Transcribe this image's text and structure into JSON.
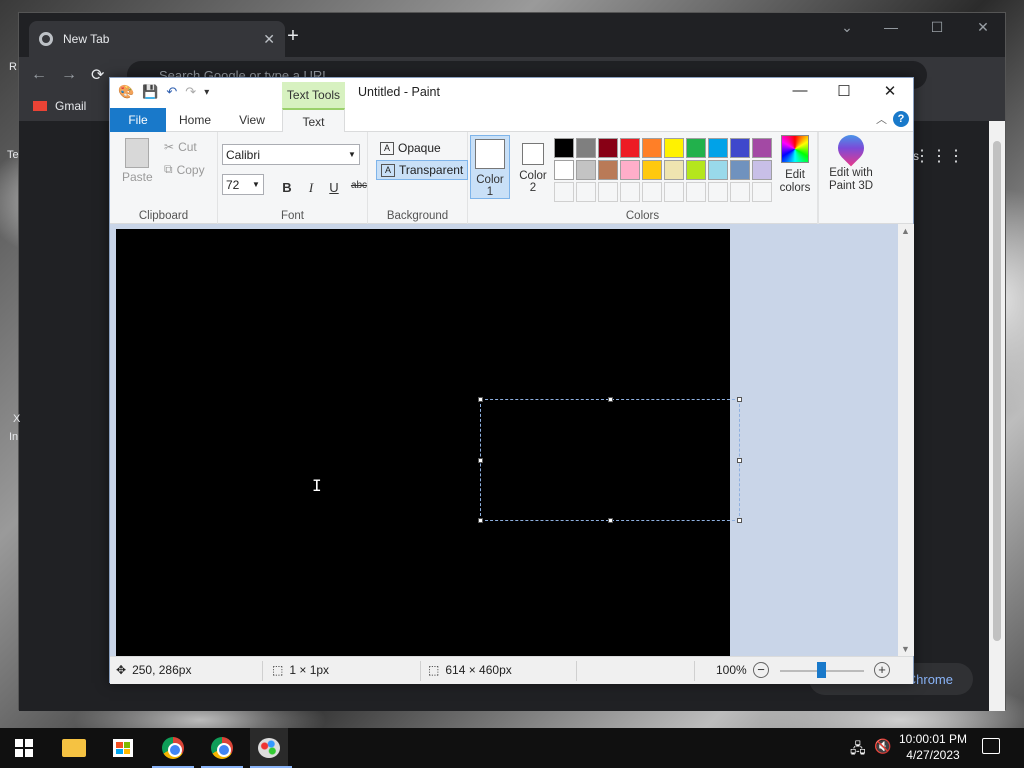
{
  "chrome": {
    "tab_title": "New Tab",
    "omnibox_placeholder": "Search Google or type a URL",
    "bookmark_gmail": "Gmail",
    "customize_label": "Chrome",
    "side_left_1": "R",
    "side_left_2": "Te",
    "side_left_3": "X",
    "side_left_4": "In",
    "side_right": "s"
  },
  "paint": {
    "context_tab": "Text Tools",
    "title": "Untitled - Paint",
    "tabs": [
      "File",
      "Home",
      "View",
      "Text"
    ],
    "clipboard": {
      "paste": "Paste",
      "cut": "Cut",
      "copy": "Copy",
      "label": "Clipboard"
    },
    "font": {
      "family": "Calibri",
      "size": "72",
      "bold": "B",
      "italic": "I",
      "underline": "U",
      "strike": "abc",
      "label": "Font"
    },
    "background": {
      "opaque": "Opaque",
      "transparent": "Transparent",
      "label": "Background"
    },
    "colors": {
      "color1_line1": "Color",
      "color1_line2": "1",
      "color2_line1": "Color",
      "color2_line2": "2",
      "edit_line1": "Edit",
      "edit_line2": "colors",
      "label": "Colors",
      "color1": "#ffffff",
      "color2": "#ffffff",
      "palette_row1": [
        "#000000",
        "#7f7f7f",
        "#880015",
        "#ed1c24",
        "#ff7f27",
        "#fff200",
        "#22b14c",
        "#00a2e8",
        "#3f48cc",
        "#a349a4"
      ],
      "palette_row2": [
        "#ffffff",
        "#c3c3c3",
        "#b97a57",
        "#ffaec9",
        "#ffc90e",
        "#efe4b0",
        "#b5e61d",
        "#99d9ea",
        "#7092be",
        "#c8bfe7"
      ],
      "palette_row3": [
        "#f5f6f7",
        "#f5f6f7",
        "#f5f6f7",
        "#f5f6f7",
        "#f5f6f7",
        "#f5f6f7",
        "#f5f6f7",
        "#f5f6f7",
        "#f5f6f7",
        "#f5f6f7"
      ]
    },
    "paint3d_line1": "Edit with",
    "paint3d_line2": "Paint 3D",
    "status": {
      "cursor_pos": "250, 286px",
      "selection_size": "1 × 1px",
      "image_size": "614 × 460px",
      "zoom": "100%"
    }
  },
  "taskbar": {
    "time": "10:00:01 PM",
    "date": "4/27/2023"
  }
}
